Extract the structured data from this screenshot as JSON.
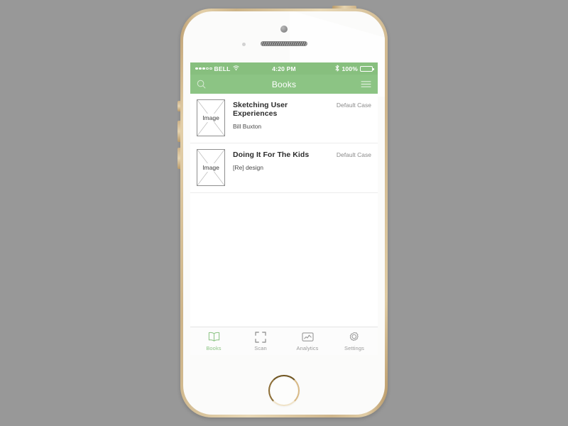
{
  "device": {
    "model_name": "smartphone-mockup",
    "body_color": "#cdb488",
    "face_color": "#fbfbfa"
  },
  "theme": {
    "status_bar_green": "#87bf7e",
    "nav_bar_green": "#8cc484",
    "accent_green": "#8cc484",
    "inactive_gray": "#9a9a9a",
    "screen_background": "#ffffff",
    "page_background": "#989898"
  },
  "status_bar": {
    "carrier": "BELL",
    "wifi_icon": "wifi-icon",
    "signal_icon": "signal-dots-icon",
    "time": "4:20 PM",
    "bluetooth_icon": "bluetooth-icon",
    "battery_percent": "100%",
    "battery_icon": "battery-full-icon"
  },
  "nav_bar": {
    "title": "Books",
    "search_icon": "search-icon",
    "menu_icon": "hamburger-menu-icon"
  },
  "book_list": {
    "thumb_placeholder_label": "Image",
    "items": [
      {
        "title": "Sketching User Experiences",
        "author": "Bill Buxton",
        "status": "Default Case"
      },
      {
        "title": "Doing It For The Kids",
        "author": "[Re] design",
        "status": "Default Case"
      }
    ]
  },
  "tab_bar": {
    "items": [
      {
        "label": "Books",
        "icon": "open-book-icon",
        "active": true
      },
      {
        "label": "Scan",
        "icon": "scan-frame-icon",
        "active": false
      },
      {
        "label": "Analytics",
        "icon": "line-chart-icon",
        "active": false
      },
      {
        "label": "Settings",
        "icon": "gear-icon",
        "active": false
      }
    ]
  }
}
